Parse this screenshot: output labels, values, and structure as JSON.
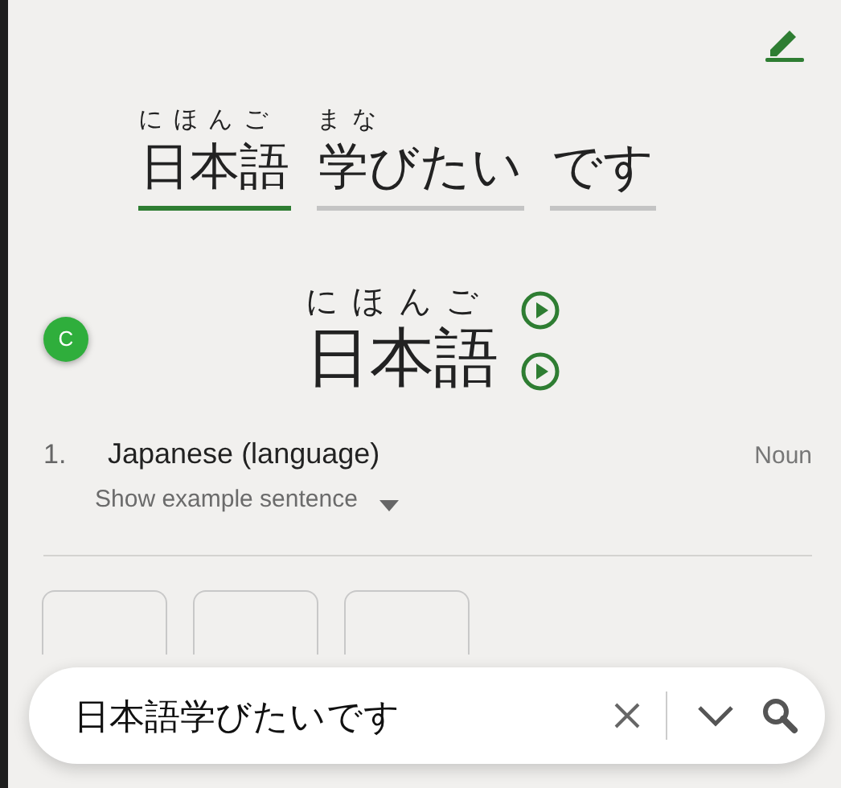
{
  "sentence": [
    {
      "text": "日本語",
      "reading": "にほんご",
      "selected": true
    },
    {
      "text": "学びたい",
      "reading": "まな",
      "selected": false
    },
    {
      "text": "です",
      "selected": false
    }
  ],
  "badge": "C",
  "entry": {
    "reading": "にほんご",
    "word": "日本語"
  },
  "senses": [
    {
      "number": "1.",
      "meaning": "Japanese (language)",
      "pos": "Noun",
      "example_toggle": "Show example sentence"
    }
  ],
  "kanji_tiles": [
    {
      "kind": "tile"
    },
    {
      "kind": "tile"
    },
    {
      "kind": "tile"
    }
  ],
  "search": {
    "value": "日本語学びたいです"
  }
}
